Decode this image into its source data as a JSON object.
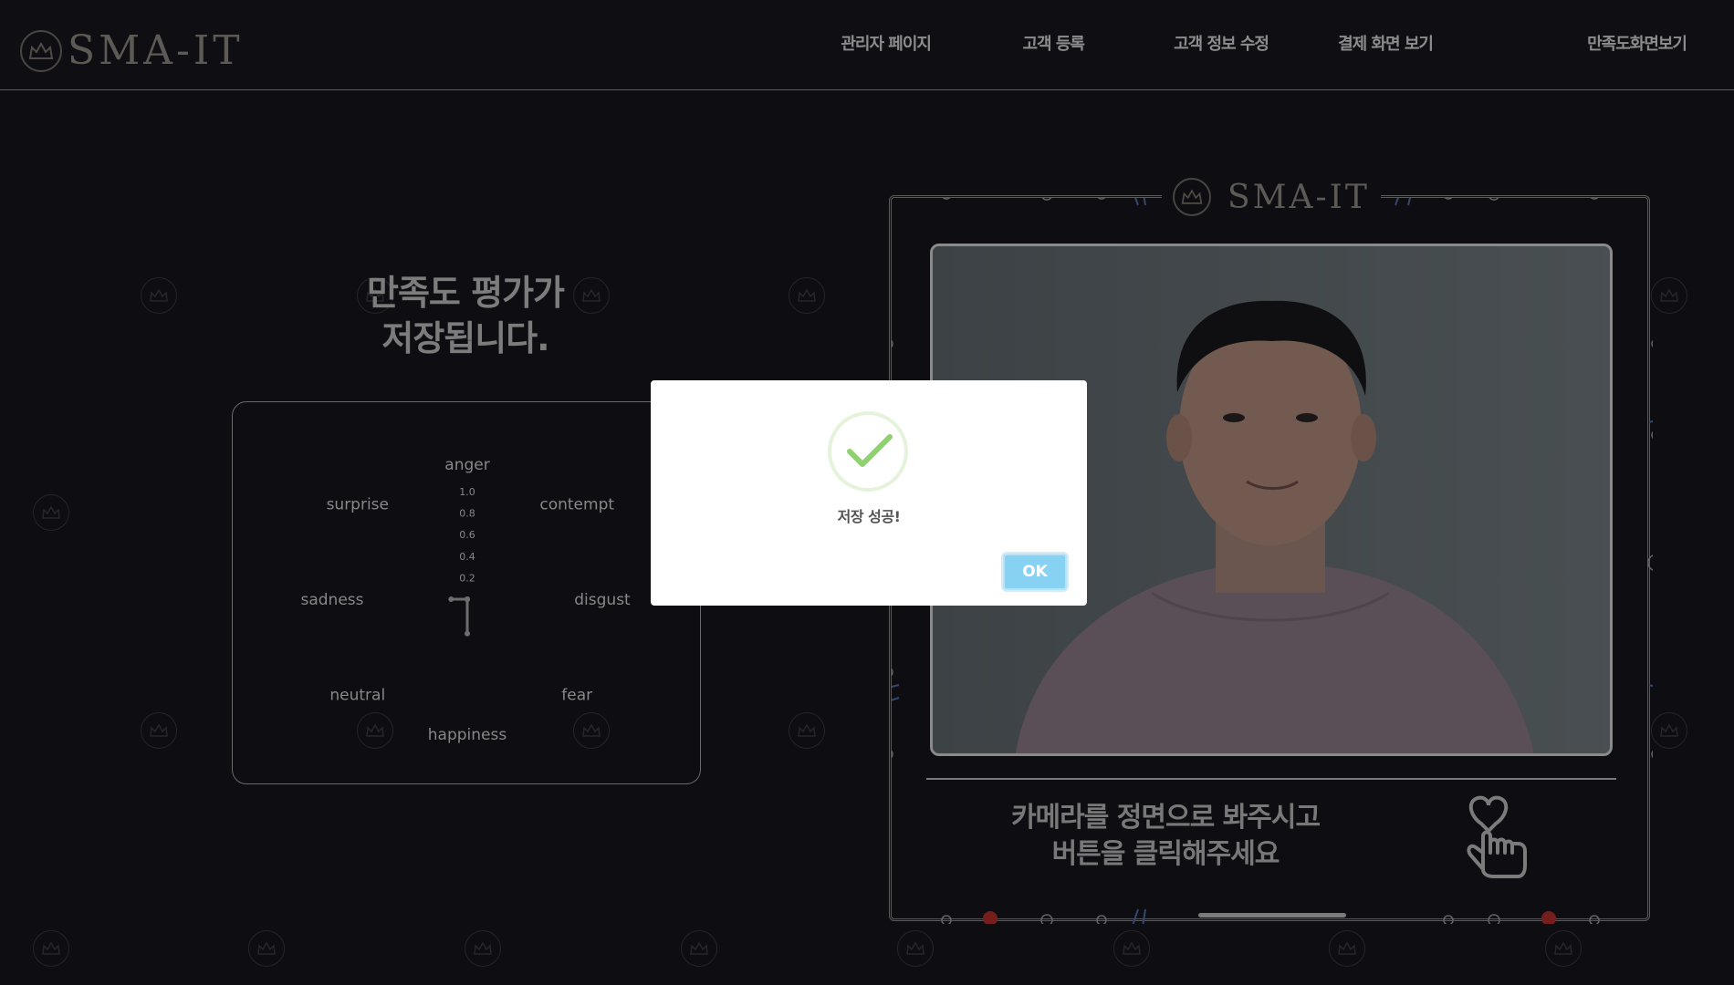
{
  "header": {
    "logo_text": "SMA-IT",
    "nav": [
      {
        "label": "관리자 페이지"
      },
      {
        "label": "고객 등록"
      },
      {
        "label": "고객 정보 수정"
      },
      {
        "label": "결제 화면 보기"
      },
      {
        "label": "만족도화면보기"
      }
    ]
  },
  "left": {
    "title_line1": "만족도 평가가",
    "title_line2": "저장됩니다."
  },
  "chart_data": {
    "type": "radar",
    "axes": [
      "anger",
      "contempt",
      "disgust",
      "fear",
      "happiness",
      "neutral",
      "sadness",
      "surprise"
    ],
    "values": [
      0,
      0,
      0,
      0,
      0.32,
      0,
      0.15,
      0
    ],
    "radial_ticks": [
      "1.0",
      "0.8",
      "0.6",
      "0.4",
      "0.2"
    ],
    "rmax": 1.0,
    "fill_color": "#a8a8a8"
  },
  "right": {
    "frame_logo_text": "SMA-IT",
    "instruction_line1": "카메라를 정면으로 봐주시고",
    "instruction_line2": "버튼을 클릭해주세요",
    "click_icon": "hand-click-icon"
  },
  "modal": {
    "icon": "check-icon",
    "message": "저장 성공!",
    "ok_label": "OK",
    "ok_color": "#87d2f3",
    "check_color": "#8fd16e"
  }
}
